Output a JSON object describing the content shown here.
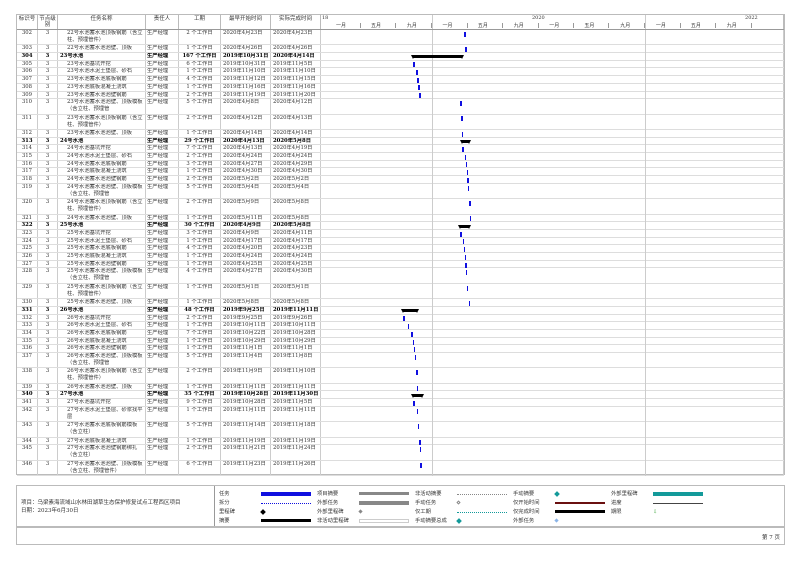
{
  "headers": [
    "标识号",
    "节点级别",
    "任务名称",
    "责任人",
    "工期",
    "最早开始时间",
    "实际完成时间"
  ],
  "timeline": {
    "years": [
      "18",
      "2020",
      "2022"
    ],
    "months": [
      "一月",
      "五月",
      "九月"
    ]
  },
  "rows": [
    [
      "302",
      "3",
      "22号水池蓄水池顶板钢筋（含立柱、预埋管件）",
      "生产经理",
      "2 个工作日",
      "2020年4月23日",
      "2020年4月23日",
      0,
      1
    ],
    [
      "303",
      "3",
      "22号水池蓄水池池壁、顶板",
      "生产经理",
      "1 个工作日",
      "2020年4月26日",
      "2020年4月26日",
      0,
      0
    ],
    [
      "304",
      "3",
      "23号水池",
      "生产经理",
      "167 个工作日",
      "2019年10月31日",
      "2020年4月14日",
      1,
      0
    ],
    [
      "305",
      "3",
      "23号水池基坑开挖",
      "生产经理",
      "6 个工作日",
      "2019年10月31日",
      "2019年11月5日",
      0,
      0
    ],
    [
      "306",
      "3",
      "23号水池水泥土垫层、砂石",
      "生产经理",
      "1 个工作日",
      "2019年11月10日",
      "2019年11月10日",
      0,
      0
    ],
    [
      "307",
      "3",
      "23号水池蓄水池底板钢筋",
      "生产经理",
      "4 个工作日",
      "2019年11月12日",
      "2019年11月15日",
      0,
      0
    ],
    [
      "308",
      "3",
      "23号水池底板混凝土浇筑",
      "生产经理",
      "1 个工作日",
      "2019年11月16日",
      "2019年11月16日",
      0,
      0
    ],
    [
      "309",
      "3",
      "23号水池蓄水池池壁钢筋",
      "生产经理",
      "2 个工作日",
      "2019年11月19日",
      "2019年11月20日",
      0,
      0
    ],
    [
      "310",
      "3",
      "23号水池蓄水池池壁、顶板模板（含立柱、预埋管",
      "生产经理",
      "5 个工作日",
      "2020年4月8日",
      "2020年4月12日",
      0,
      1
    ],
    [
      "311",
      "3",
      "23号水池蓄水池顶板钢筋（含立柱、预埋管件）",
      "生产经理",
      "2 个工作日",
      "2020年4月12日",
      "2020年4月13日",
      0,
      1
    ],
    [
      "312",
      "3",
      "23号水池蓄水池池壁、顶板",
      "生产经理",
      "1 个工作日",
      "2020年4月14日",
      "2020年4月14日",
      0,
      0
    ],
    [
      "313",
      "3",
      "24号水池",
      "生产经理",
      "29 个工作日",
      "2020年4月13日",
      "2020年5月8日",
      1,
      0
    ],
    [
      "314",
      "3",
      "24号水池基坑开挖",
      "生产经理",
      "7 个工作日",
      "2020年4月13日",
      "2020年4月19日",
      0,
      0
    ],
    [
      "315",
      "3",
      "24号水池水泥土垫层、砂石",
      "生产经理",
      "2 个工作日",
      "2020年4月24日",
      "2020年4月24日",
      0,
      0
    ],
    [
      "316",
      "3",
      "24号水池蓄水池底板钢筋",
      "生产经理",
      "3 个工作日",
      "2020年4月27日",
      "2020年4月29日",
      0,
      0
    ],
    [
      "317",
      "3",
      "24号水池底板混凝土浇筑",
      "生产经理",
      "1 个工作日",
      "2020年4月30日",
      "2020年4月30日",
      0,
      0
    ],
    [
      "318",
      "3",
      "24号水池蓄水池池壁钢筋",
      "生产经理",
      "2 个工作日",
      "2020年5月2日",
      "2020年5月2日",
      0,
      0
    ],
    [
      "319",
      "3",
      "24号水池蓄水池池壁、顶板模板（含立柱、预埋管",
      "生产经理",
      "5 个工作日",
      "2020年5月4日",
      "2020年5月4日",
      0,
      1
    ],
    [
      "320",
      "3",
      "24号水池蓄水池顶板钢筋（含立柱、预埋管件）",
      "生产经理",
      "2 个工作日",
      "2020年5月9日",
      "2020年5月8日",
      0,
      1
    ],
    [
      "321",
      "3",
      "24号水池蓄水池池壁、顶板",
      "生产经理",
      "1 个工作日",
      "2020年5月11日",
      "2020年5月8日",
      0,
      0
    ],
    [
      "322",
      "3",
      "25号水池",
      "生产经理",
      "30 个工作日",
      "2020年4月9日",
      "2020年5月8日",
      1,
      0
    ],
    [
      "323",
      "3",
      "25号水池基坑开挖",
      "生产经理",
      "3 个工作日",
      "2020年4月9日",
      "2020年4月11日",
      0,
      0
    ],
    [
      "324",
      "3",
      "25号水池水泥土垫层、砂石",
      "生产经理",
      "1 个工作日",
      "2020年4月17日",
      "2020年4月17日",
      0,
      0
    ],
    [
      "325",
      "3",
      "25号水池蓄水池底板钢筋",
      "生产经理",
      "4 个工作日",
      "2020年4月20日",
      "2020年4月23日",
      0,
      0
    ],
    [
      "326",
      "3",
      "25号水池底板混凝土浇筑",
      "生产经理",
      "1 个工作日",
      "2020年4月24日",
      "2020年4月24日",
      0,
      0
    ],
    [
      "327",
      "3",
      "25号水池蓄水池池壁钢筋",
      "生产经理",
      "1 个工作日",
      "2020年4月25日",
      "2020年4月25日",
      0,
      0
    ],
    [
      "328",
      "3",
      "25号水池蓄水池池壁、顶板模板（含立柱、预埋管",
      "生产经理",
      "4 个工作日",
      "2020年4月27日",
      "2020年4月30日",
      0,
      1
    ],
    [
      "329",
      "3",
      "25号水池蓄水池顶板钢筋（含立柱、预埋管件）",
      "生产经理",
      "1 个工作日",
      "2020年5月1日",
      "2020年5月1日",
      0,
      1
    ],
    [
      "330",
      "3",
      "25号水池蓄水池池壁、顶板",
      "生产经理",
      "1 个工作日",
      "2020年5月8日",
      "2020年5月8日",
      0,
      0
    ],
    [
      "331",
      "3",
      "26号水池",
      "生产经理",
      "48 个工作日",
      "2019年9月25日",
      "2019年11月11日",
      1,
      0
    ],
    [
      "332",
      "3",
      "26号水池基坑开挖",
      "生产经理",
      "2 个工作日",
      "2019年9月25日",
      "2019年9月26日",
      0,
      0
    ],
    [
      "333",
      "3",
      "26号水池水泥土垫层、砂石",
      "生产经理",
      "1 个工作日",
      "2019年10月11日",
      "2019年10月11日",
      0,
      0
    ],
    [
      "334",
      "3",
      "26号水池蓄水池底板钢筋",
      "生产经理",
      "7 个工作日",
      "2019年10月22日",
      "2019年10月28日",
      0,
      0
    ],
    [
      "335",
      "3",
      "26号水池底板混凝土浇筑",
      "生产经理",
      "1 个工作日",
      "2019年10月29日",
      "2019年10月29日",
      0,
      0
    ],
    [
      "336",
      "3",
      "26号水池蓄水池池壁钢筋",
      "生产经理",
      "1 个工作日",
      "2019年11月1日",
      "2019年11月1日",
      0,
      0
    ],
    [
      "337",
      "3",
      "26号水池蓄水池池壁、顶板模板（含立柱、预埋管",
      "生产经理",
      "5 个工作日",
      "2019年11月4日",
      "2019年11月8日",
      0,
      1
    ],
    [
      "338",
      "3",
      "26号水池蓄水池顶板钢筋（含立柱、预埋管件）",
      "生产经理",
      "2 个工作日",
      "2019年11月9日",
      "2019年11月10日",
      0,
      1
    ],
    [
      "339",
      "3",
      "26号水池蓄水池池壁、顶板",
      "生产经理",
      "1 个工作日",
      "2019年11月11日",
      "2019年11月11日",
      0,
      0
    ],
    [
      "340",
      "3",
      "27号水池",
      "生产经理",
      "35 个工作日",
      "2019年10月28日",
      "2019年11月30日",
      1,
      0
    ],
    [
      "341",
      "3",
      "27号水池基坑开挖",
      "生产经理",
      "9 个工作日",
      "2019年10月28日",
      "2019年11月5日",
      0,
      0
    ],
    [
      "342",
      "3",
      "27号水池水泥土垫层、砂浆找平层",
      "生产经理",
      "1 个工作日",
      "2019年11月11日",
      "2019年11月11日",
      0,
      1
    ],
    [
      "343",
      "3",
      "27号水池蓄水池底板钢筋模板（含立柱）",
      "生产经理",
      "5 个工作日",
      "2019年11月14日",
      "2019年11月18日",
      0,
      1
    ],
    [
      "344",
      "3",
      "27号水池底板混凝土浇筑",
      "生产经理",
      "1 个工作日",
      "2019年11月19日",
      "2019年11月19日",
      0,
      0
    ],
    [
      "345",
      "3",
      "27号水池蓄水池池壁钢筋绑扎（含立柱）",
      "生产经理",
      "2 个工作日",
      "2019年11月21日",
      "2019年11月24日",
      0,
      1
    ],
    [
      "346",
      "3",
      "27号水池蓄水池池壁、顶板模板（含立柱、预埋管件）",
      "生产经理",
      "6 个工作日",
      "2019年11月23日",
      "2019年11月26日",
      0,
      1
    ]
  ],
  "footer": {
    "project": "项目：乌梁素海流域山水林田湖草生态保护修复试点工程西区项目",
    "date": "日期：2023年6月30日",
    "page": "第 7 页"
  },
  "legend": [
    [
      "任务",
      "task"
    ],
    [
      "拆分",
      "split"
    ],
    [
      "里程碑",
      "milestone"
    ],
    [
      "摘要",
      "summary"
    ],
    [
      "项目摘要",
      "projsum"
    ],
    [
      "外部任务",
      "exttask"
    ],
    [
      "外部里程碑",
      "extms"
    ],
    [
      "非活动里程碑",
      "inactive"
    ],
    [
      "非活动摘要",
      "dotgray"
    ],
    [
      "手动任务",
      "hollow"
    ],
    [
      "仅工期",
      "dotteal"
    ],
    [
      "手动摘要总成",
      "tealdot"
    ],
    [
      "手动摘要",
      "tealdot"
    ],
    [
      "仅开始时间",
      "darkred"
    ],
    [
      "仅完成时间",
      "summary"
    ],
    [
      "外部任务",
      "bluedot"
    ],
    [
      "外部里程碑",
      "tealbar"
    ],
    [
      "进度",
      "grayline"
    ],
    [
      "期限",
      "arrow"
    ]
  ],
  "colors": {
    "task": "#1010e0",
    "summary": "#000000",
    "teal": "#139a9a"
  }
}
